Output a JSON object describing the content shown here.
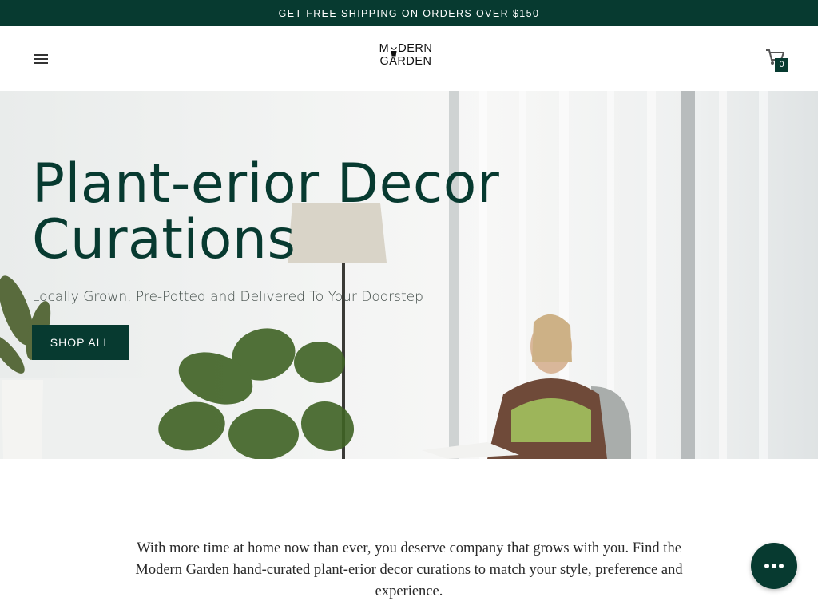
{
  "announcement": {
    "text": "GET FREE SHIPPING ON ORDERS OVER $150"
  },
  "header": {
    "menu_icon": "hamburger-menu-icon",
    "logo": {
      "line1": "MODERN",
      "line2": "GARDEN"
    },
    "cart": {
      "icon": "cart-icon",
      "count": "0"
    }
  },
  "hero": {
    "title_line1": "Plant-erior Decor",
    "title_line2": "Curations",
    "subtitle": "Locally Grown, Pre-Potted and Delivered To Your Doorstep",
    "cta_label": "SHOP ALL"
  },
  "intro": {
    "text": "With more time at home now than ever, you deserve company that grows with you. Find the Modern Garden hand-curated plant-erior decor curations to match your style, preference and experience."
  },
  "chat": {
    "icon": "chat-bubble-icon"
  },
  "colors": {
    "brand": "#073a30",
    "text": "#2b2b2b",
    "background": "#ffffff"
  }
}
